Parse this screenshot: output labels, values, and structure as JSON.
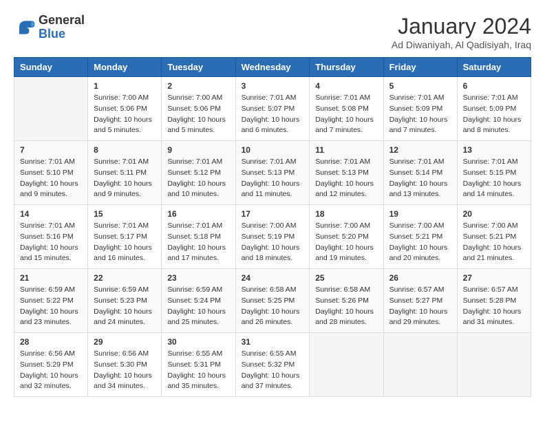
{
  "header": {
    "logo": {
      "line1": "General",
      "line2": "Blue"
    },
    "title": "January 2024",
    "subtitle": "Ad Diwaniyah, Al Qadisiyah, Iraq"
  },
  "weekdays": [
    "Sunday",
    "Monday",
    "Tuesday",
    "Wednesday",
    "Thursday",
    "Friday",
    "Saturday"
  ],
  "weeks": [
    [
      {
        "day": "",
        "sunrise": "",
        "sunset": "",
        "daylight": ""
      },
      {
        "day": "1",
        "sunrise": "Sunrise: 7:00 AM",
        "sunset": "Sunset: 5:06 PM",
        "daylight": "Daylight: 10 hours and 5 minutes."
      },
      {
        "day": "2",
        "sunrise": "Sunrise: 7:00 AM",
        "sunset": "Sunset: 5:06 PM",
        "daylight": "Daylight: 10 hours and 5 minutes."
      },
      {
        "day": "3",
        "sunrise": "Sunrise: 7:01 AM",
        "sunset": "Sunset: 5:07 PM",
        "daylight": "Daylight: 10 hours and 6 minutes."
      },
      {
        "day": "4",
        "sunrise": "Sunrise: 7:01 AM",
        "sunset": "Sunset: 5:08 PM",
        "daylight": "Daylight: 10 hours and 7 minutes."
      },
      {
        "day": "5",
        "sunrise": "Sunrise: 7:01 AM",
        "sunset": "Sunset: 5:09 PM",
        "daylight": "Daylight: 10 hours and 7 minutes."
      },
      {
        "day": "6",
        "sunrise": "Sunrise: 7:01 AM",
        "sunset": "Sunset: 5:09 PM",
        "daylight": "Daylight: 10 hours and 8 minutes."
      }
    ],
    [
      {
        "day": "7",
        "sunrise": "Sunrise: 7:01 AM",
        "sunset": "Sunset: 5:10 PM",
        "daylight": "Daylight: 10 hours and 9 minutes."
      },
      {
        "day": "8",
        "sunrise": "Sunrise: 7:01 AM",
        "sunset": "Sunset: 5:11 PM",
        "daylight": "Daylight: 10 hours and 9 minutes."
      },
      {
        "day": "9",
        "sunrise": "Sunrise: 7:01 AM",
        "sunset": "Sunset: 5:12 PM",
        "daylight": "Daylight: 10 hours and 10 minutes."
      },
      {
        "day": "10",
        "sunrise": "Sunrise: 7:01 AM",
        "sunset": "Sunset: 5:13 PM",
        "daylight": "Daylight: 10 hours and 11 minutes."
      },
      {
        "day": "11",
        "sunrise": "Sunrise: 7:01 AM",
        "sunset": "Sunset: 5:13 PM",
        "daylight": "Daylight: 10 hours and 12 minutes."
      },
      {
        "day": "12",
        "sunrise": "Sunrise: 7:01 AM",
        "sunset": "Sunset: 5:14 PM",
        "daylight": "Daylight: 10 hours and 13 minutes."
      },
      {
        "day": "13",
        "sunrise": "Sunrise: 7:01 AM",
        "sunset": "Sunset: 5:15 PM",
        "daylight": "Daylight: 10 hours and 14 minutes."
      }
    ],
    [
      {
        "day": "14",
        "sunrise": "Sunrise: 7:01 AM",
        "sunset": "Sunset: 5:16 PM",
        "daylight": "Daylight: 10 hours and 15 minutes."
      },
      {
        "day": "15",
        "sunrise": "Sunrise: 7:01 AM",
        "sunset": "Sunset: 5:17 PM",
        "daylight": "Daylight: 10 hours and 16 minutes."
      },
      {
        "day": "16",
        "sunrise": "Sunrise: 7:01 AM",
        "sunset": "Sunset: 5:18 PM",
        "daylight": "Daylight: 10 hours and 17 minutes."
      },
      {
        "day": "17",
        "sunrise": "Sunrise: 7:00 AM",
        "sunset": "Sunset: 5:19 PM",
        "daylight": "Daylight: 10 hours and 18 minutes."
      },
      {
        "day": "18",
        "sunrise": "Sunrise: 7:00 AM",
        "sunset": "Sunset: 5:20 PM",
        "daylight": "Daylight: 10 hours and 19 minutes."
      },
      {
        "day": "19",
        "sunrise": "Sunrise: 7:00 AM",
        "sunset": "Sunset: 5:21 PM",
        "daylight": "Daylight: 10 hours and 20 minutes."
      },
      {
        "day": "20",
        "sunrise": "Sunrise: 7:00 AM",
        "sunset": "Sunset: 5:21 PM",
        "daylight": "Daylight: 10 hours and 21 minutes."
      }
    ],
    [
      {
        "day": "21",
        "sunrise": "Sunrise: 6:59 AM",
        "sunset": "Sunset: 5:22 PM",
        "daylight": "Daylight: 10 hours and 23 minutes."
      },
      {
        "day": "22",
        "sunrise": "Sunrise: 6:59 AM",
        "sunset": "Sunset: 5:23 PM",
        "daylight": "Daylight: 10 hours and 24 minutes."
      },
      {
        "day": "23",
        "sunrise": "Sunrise: 6:59 AM",
        "sunset": "Sunset: 5:24 PM",
        "daylight": "Daylight: 10 hours and 25 minutes."
      },
      {
        "day": "24",
        "sunrise": "Sunrise: 6:58 AM",
        "sunset": "Sunset: 5:25 PM",
        "daylight": "Daylight: 10 hours and 26 minutes."
      },
      {
        "day": "25",
        "sunrise": "Sunrise: 6:58 AM",
        "sunset": "Sunset: 5:26 PM",
        "daylight": "Daylight: 10 hours and 28 minutes."
      },
      {
        "day": "26",
        "sunrise": "Sunrise: 6:57 AM",
        "sunset": "Sunset: 5:27 PM",
        "daylight": "Daylight: 10 hours and 29 minutes."
      },
      {
        "day": "27",
        "sunrise": "Sunrise: 6:57 AM",
        "sunset": "Sunset: 5:28 PM",
        "daylight": "Daylight: 10 hours and 31 minutes."
      }
    ],
    [
      {
        "day": "28",
        "sunrise": "Sunrise: 6:56 AM",
        "sunset": "Sunset: 5:29 PM",
        "daylight": "Daylight: 10 hours and 32 minutes."
      },
      {
        "day": "29",
        "sunrise": "Sunrise: 6:56 AM",
        "sunset": "Sunset: 5:30 PM",
        "daylight": "Daylight: 10 hours and 34 minutes."
      },
      {
        "day": "30",
        "sunrise": "Sunrise: 6:55 AM",
        "sunset": "Sunset: 5:31 PM",
        "daylight": "Daylight: 10 hours and 35 minutes."
      },
      {
        "day": "31",
        "sunrise": "Sunrise: 6:55 AM",
        "sunset": "Sunset: 5:32 PM",
        "daylight": "Daylight: 10 hours and 37 minutes."
      },
      {
        "day": "",
        "sunrise": "",
        "sunset": "",
        "daylight": ""
      },
      {
        "day": "",
        "sunrise": "",
        "sunset": "",
        "daylight": ""
      },
      {
        "day": "",
        "sunrise": "",
        "sunset": "",
        "daylight": ""
      }
    ]
  ]
}
